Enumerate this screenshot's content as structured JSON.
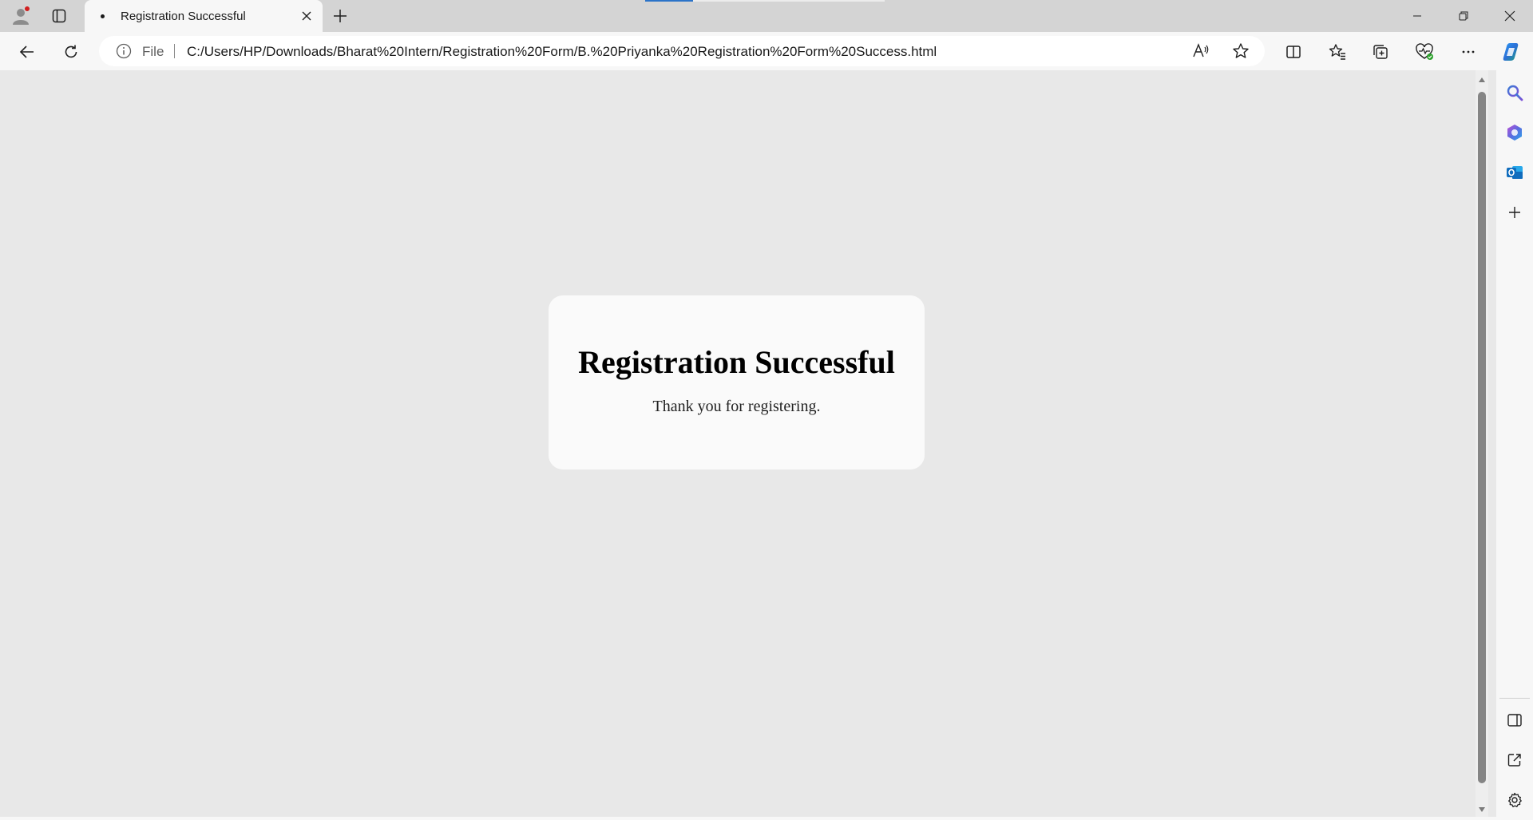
{
  "tab": {
    "title": "Registration Successful",
    "new_tab_icon": "plus-icon",
    "close_icon": "close-icon"
  },
  "address_bar": {
    "scheme_label": "File",
    "url": "C:/Users/HP/Downloads/Bharat%20Intern/Registration%20Form/B.%20Priyanka%20Registration%20Form%20Success.html"
  },
  "page": {
    "heading": "Registration Successful",
    "message": "Thank you for registering."
  },
  "toolbar_icons": [
    "back-arrow-icon",
    "refresh-icon",
    "read-aloud-icon",
    "favorite-star-icon",
    "split-screen-icon",
    "favorites-icon",
    "collections-icon",
    "browser-essentials-icon",
    "more-options-icon",
    "copilot-icon"
  ],
  "sidebar_icons": [
    "search-icon",
    "copilot-app-icon",
    "outlook-icon",
    "add-icon",
    "hide-sidebar-icon",
    "open-external-icon",
    "settings-icon"
  ],
  "colors": {
    "page_background": "#e8e8e8",
    "card_background": "#fafafa",
    "tab_strip": "#d4d4d4",
    "profile_badge": "#d11f1f",
    "outlook_blue": "#0f6cbd"
  }
}
